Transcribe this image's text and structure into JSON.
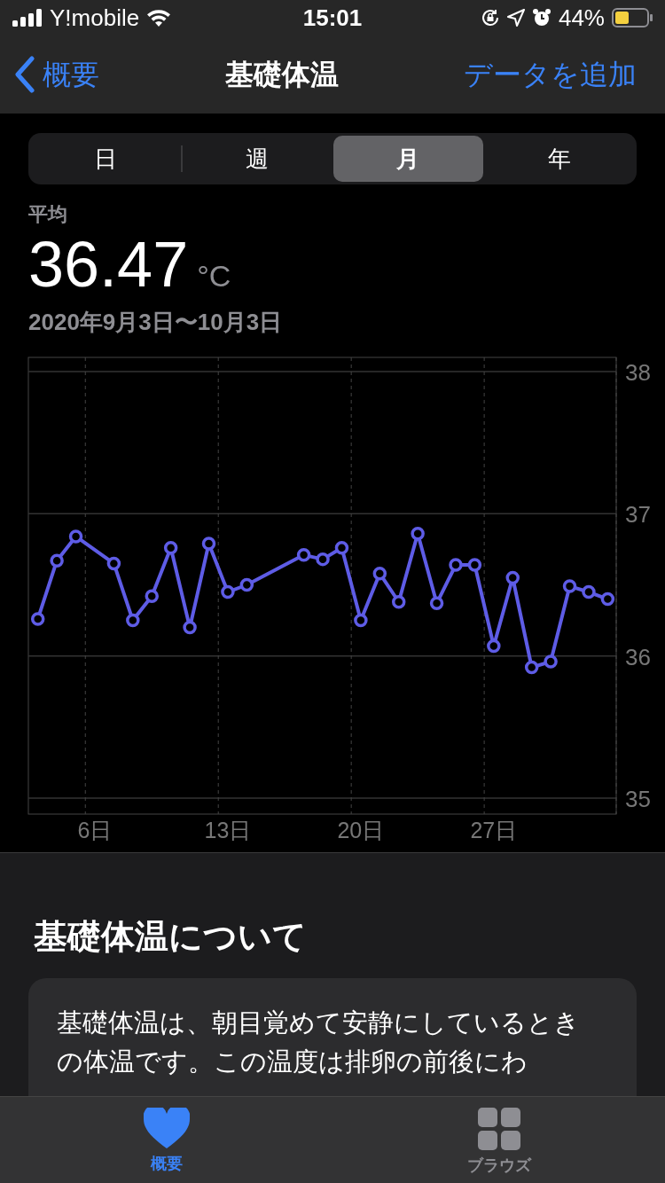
{
  "status_bar": {
    "carrier": "Y!mobile",
    "time": "15:01",
    "battery": "44%"
  },
  "nav": {
    "back": "概要",
    "title": "基礎体温",
    "action": "データを追加"
  },
  "segments": [
    {
      "label": "日",
      "selected": false
    },
    {
      "label": "週",
      "selected": false
    },
    {
      "label": "月",
      "selected": true
    },
    {
      "label": "年",
      "selected": false
    }
  ],
  "summary": {
    "label": "平均",
    "value": "36.47",
    "unit": "°C",
    "range": "2020年9月3日〜10月3日"
  },
  "chart_data": {
    "type": "line",
    "x": [
      3,
      4,
      5,
      7,
      8,
      9,
      10,
      11,
      12,
      13,
      14,
      17,
      18,
      19,
      20,
      21,
      22,
      23,
      24,
      25,
      26,
      27,
      28,
      29,
      30,
      31,
      32,
      33
    ],
    "series": [
      {
        "color": "#5e5ce6",
        "marker": "circle",
        "values": [
          36.26,
          36.67,
          36.84,
          36.65,
          36.25,
          36.42,
          36.76,
          36.2,
          36.79,
          36.45,
          36.5,
          36.71,
          36.68,
          36.76,
          36.25,
          36.58,
          36.38,
          36.86,
          36.37,
          36.64,
          36.64,
          36.07,
          36.55,
          35.92,
          35.96,
          36.49,
          36.45,
          36.4
        ]
      }
    ],
    "xlim": [
      2.5,
      33.45
    ],
    "ylim": [
      35,
      38
    ],
    "xticks": [
      {
        "value": 6,
        "label": "6日"
      },
      {
        "value": 13,
        "label": "13日"
      },
      {
        "value": 20,
        "label": "20日"
      },
      {
        "value": 27,
        "label": "27日"
      }
    ],
    "yticks": [
      38,
      37,
      36,
      35
    ]
  },
  "about": {
    "heading": "基礎体温について",
    "text": "基礎体温は、朝目覚めて安静にしているときの体温です。この温度は排卵の前後にわ"
  },
  "tab_bar": [
    {
      "label": "概要",
      "kind": "heart",
      "selected": true
    },
    {
      "label": "ブラウズ",
      "kind": "grid",
      "selected": false
    }
  ]
}
